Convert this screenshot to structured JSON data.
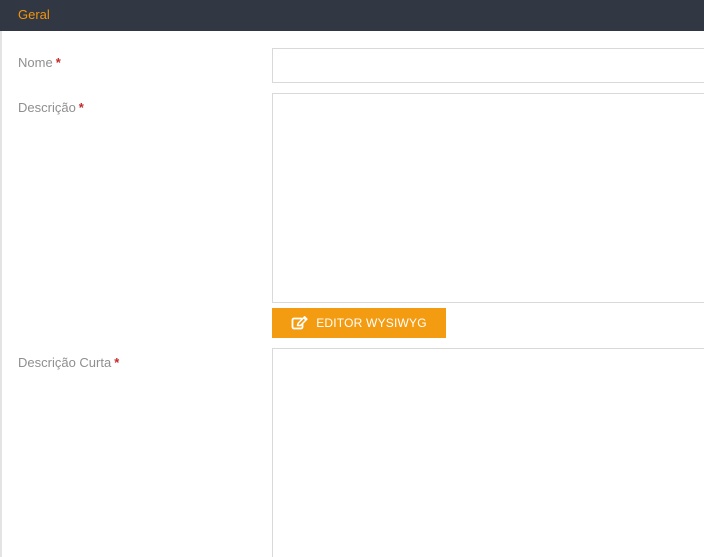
{
  "section": {
    "title": "Geral"
  },
  "fields": {
    "nome": {
      "label": "Nome",
      "required_mark": "*",
      "value": ""
    },
    "descricao": {
      "label": "Descrição",
      "required_mark": "*",
      "value": ""
    },
    "descricao_curta": {
      "label": "Descrição Curta",
      "required_mark": "*",
      "value": ""
    }
  },
  "editor_button": {
    "label": "EDITOR WYSIWYG",
    "icon": "edit-icon"
  },
  "colors": {
    "header_background": "#323843",
    "header_text": "#f0950f",
    "button_background": "#f39c12",
    "required": "#c62828",
    "label_text": "#8f8f8f"
  }
}
